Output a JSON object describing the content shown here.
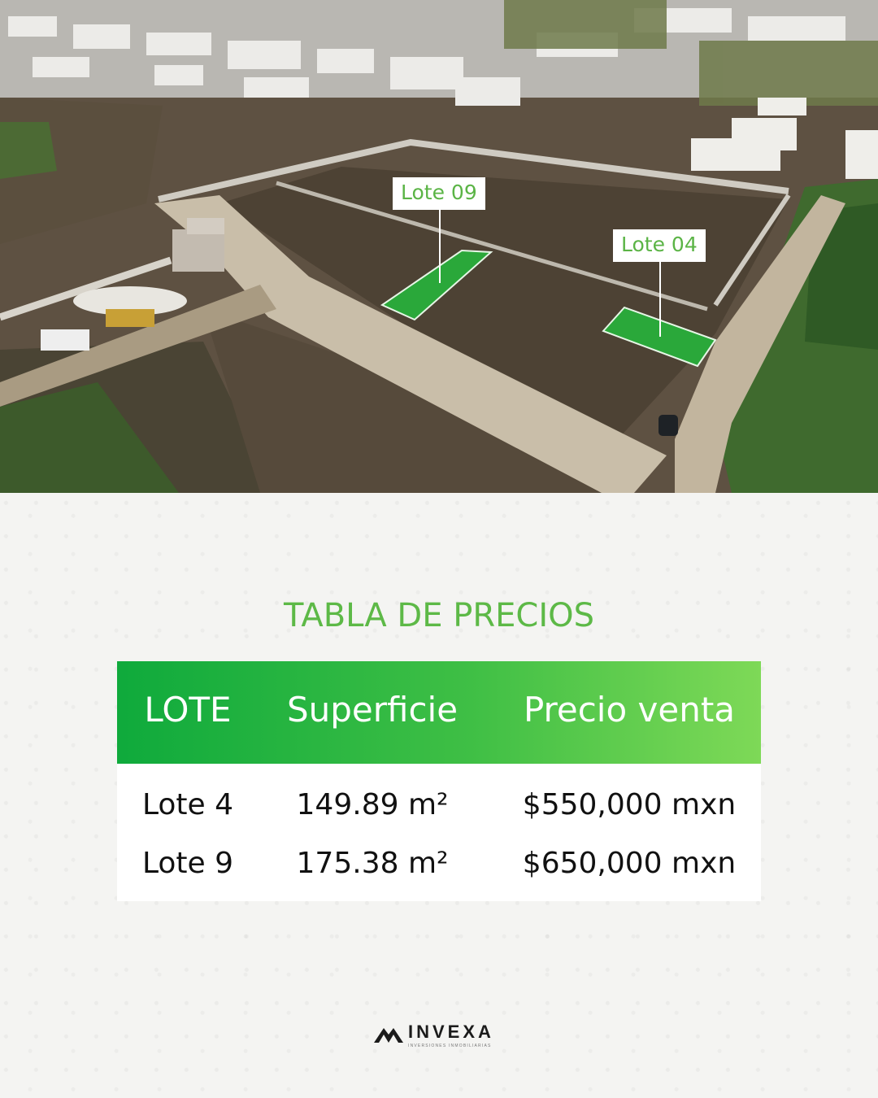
{
  "photo": {
    "labels": [
      {
        "text": "Lote 09"
      },
      {
        "text": "Lote 04"
      }
    ]
  },
  "price_table": {
    "title": "TABLA DE PRECIOS",
    "headers": [
      "LOTE",
      "Superficie",
      "Precio venta"
    ],
    "rows": [
      [
        "Lote 4",
        "149.89 m²",
        "$550,000 mxn"
      ],
      [
        "Lote 9",
        "175.38 m²",
        "$650,000 mxn"
      ]
    ],
    "header_gradient": [
      "#0faa3c",
      "#7ed957"
    ],
    "title_color": "#5db947"
  },
  "brand": {
    "name": "INVEXA",
    "tagline": "INVERSIONES INMOBILIARIAS"
  }
}
